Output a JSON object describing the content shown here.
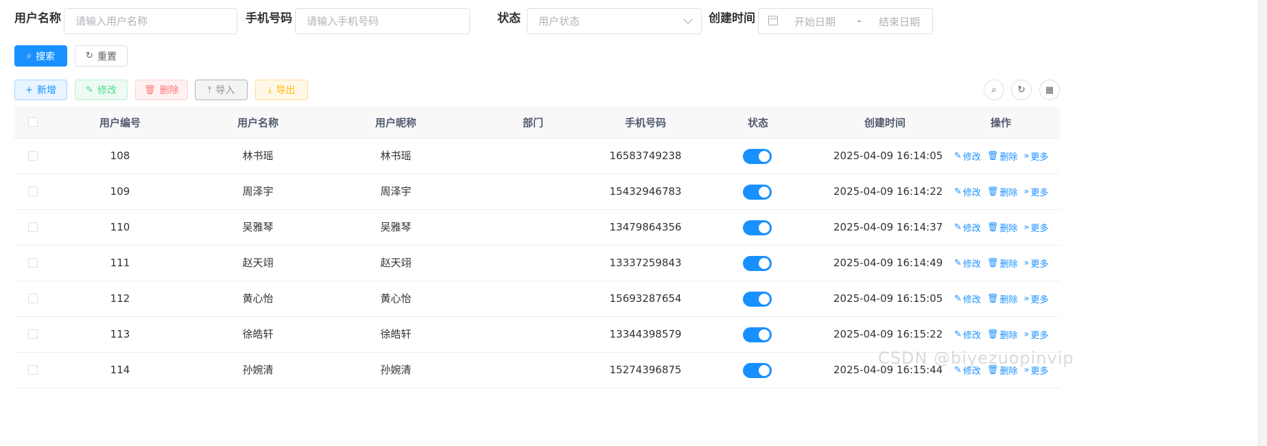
{
  "search_form": {
    "username_label": "用户名称",
    "username_placeholder": "请输入用户名称",
    "phone_label": "手机号码",
    "phone_placeholder": "请输入手机号码",
    "status_label": "状态",
    "status_placeholder": "用户状态",
    "created_label": "创建时间",
    "date_start_placeholder": "开始日期",
    "date_separator": "-",
    "date_end_placeholder": "结束日期"
  },
  "actions": {
    "search_label": "搜索",
    "reset_label": "重置"
  },
  "toolbar": {
    "add_label": "新增",
    "edit_label": "修改",
    "delete_label": "删除",
    "import_label": "导入",
    "export_label": "导出"
  },
  "table": {
    "columns": [
      "用户编号",
      "用户名称",
      "用户昵称",
      "部门",
      "手机号码",
      "状态",
      "创建时间",
      "操作"
    ],
    "row_actions": {
      "edit": "修改",
      "delete": "删除",
      "more": "更多"
    },
    "rows": [
      {
        "id": "108",
        "username": "林书瑶",
        "nickname": "林书瑶",
        "dept": "",
        "phone": "16583749238",
        "status_on": true,
        "created": "2025-04-09 16:14:05"
      },
      {
        "id": "109",
        "username": "周泽宇",
        "nickname": "周泽宇",
        "dept": "",
        "phone": "15432946783",
        "status_on": true,
        "created": "2025-04-09 16:14:22"
      },
      {
        "id": "110",
        "username": "吴雅琴",
        "nickname": "吴雅琴",
        "dept": "",
        "phone": "13479864356",
        "status_on": true,
        "created": "2025-04-09 16:14:37"
      },
      {
        "id": "111",
        "username": "赵天翊",
        "nickname": "赵天翊",
        "dept": "",
        "phone": "13337259843",
        "status_on": true,
        "created": "2025-04-09 16:14:49"
      },
      {
        "id": "112",
        "username": "黄心怡",
        "nickname": "黄心怡",
        "dept": "",
        "phone": "15693287654",
        "status_on": true,
        "created": "2025-04-09 16:15:05"
      },
      {
        "id": "113",
        "username": "徐皓轩",
        "nickname": "徐皓轩",
        "dept": "",
        "phone": "13344398579",
        "status_on": true,
        "created": "2025-04-09 16:15:22"
      },
      {
        "id": "114",
        "username": "孙婉清",
        "nickname": "孙婉清",
        "dept": "",
        "phone": "15274396875",
        "status_on": true,
        "created": "2025-04-09 16:15:44"
      }
    ]
  },
  "watermark": "CSDN @biyezuopinvip",
  "colors": {
    "primary": "#1890ff",
    "success": "#13ce66",
    "danger": "#ff4949",
    "warning": "#ffba00",
    "info": "#909399"
  }
}
